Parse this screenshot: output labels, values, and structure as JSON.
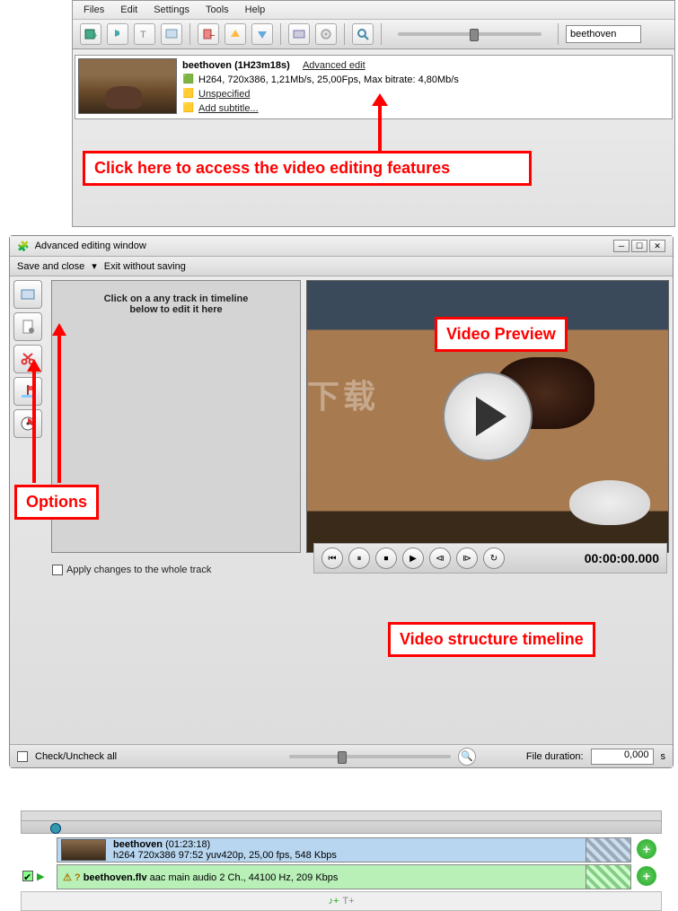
{
  "menu": {
    "files": "Files",
    "edit": "Edit",
    "settings": "Settings",
    "tools": "Tools",
    "help": "Help"
  },
  "search": {
    "value": "beethoven"
  },
  "file": {
    "title": "beethoven (1H23m18s)",
    "advanced": "Advanced edit",
    "video": "H264, 720x386, 1,21Mb/s, 25,00Fps, Max bitrate: 4,80Mb/s",
    "audio": "Unspecified",
    "subtitle": "Add subtitle..."
  },
  "annot": {
    "access": "Click here to access the video editing features",
    "preview": "Video Preview",
    "options": "Options",
    "timeline": "Video structure timeline"
  },
  "adv": {
    "title": "Advanced editing window",
    "save": "Save and close",
    "exit": "Exit without saving",
    "panel1": "Click on a any track in timeline",
    "panel2": "below to edit it here",
    "apply": "Apply changes to the whole track"
  },
  "controls": {
    "timecode": "00:00:00.000"
  },
  "track_video": {
    "name": "beethoven",
    "dur": "(01:23:18)",
    "details": "h264 720x386 97:52 yuv420p, 25,00 fps, 548 Kbps"
  },
  "track_audio": {
    "name": "beethoven.flv",
    "details": "aac main audio 2 Ch., 44100 Hz, 209 Kbps"
  },
  "status": {
    "check": "Check/Uncheck all",
    "filedur": "File duration:",
    "value": "0,000",
    "unit": "s"
  }
}
